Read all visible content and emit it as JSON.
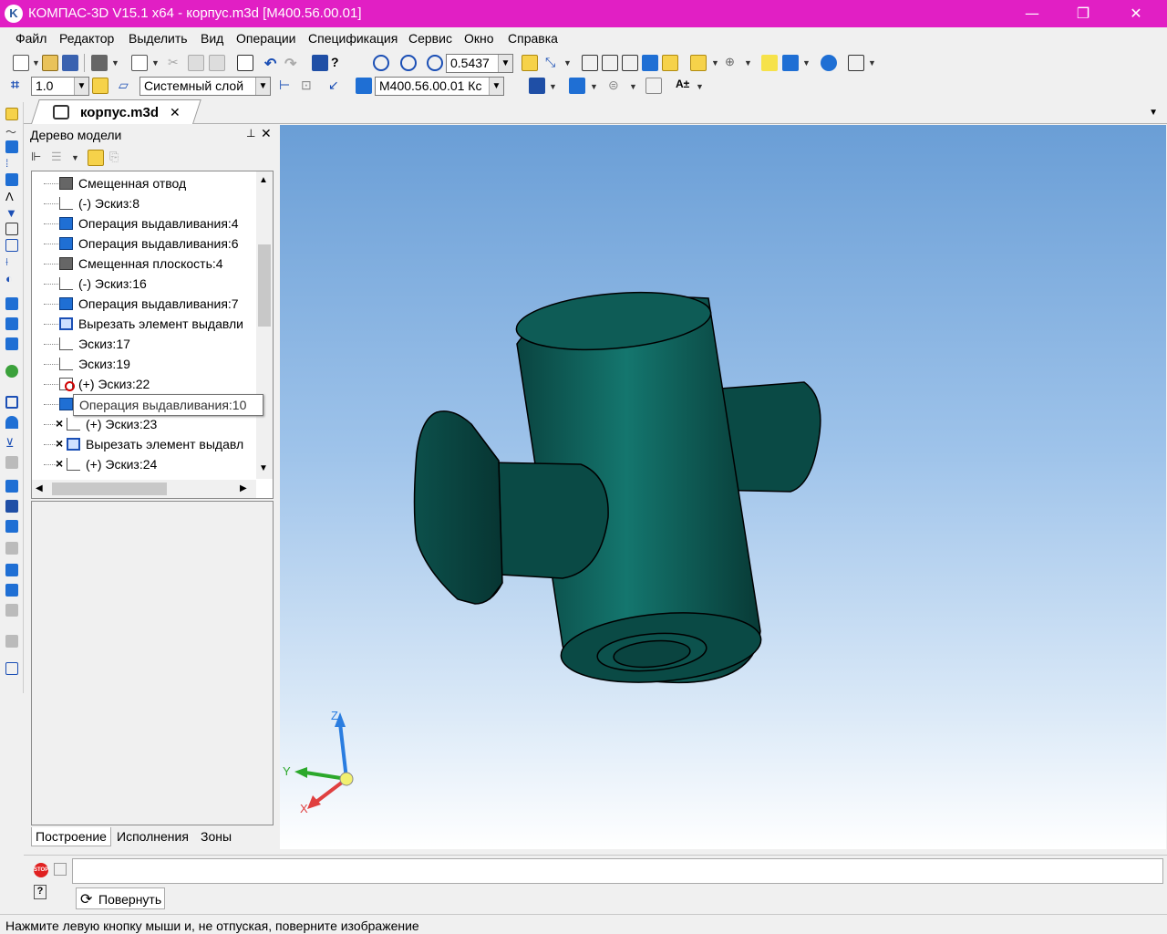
{
  "window": {
    "title": "КОМПАС-3D V15.1 x64 - корпус.m3d [M400.56.00.01]",
    "app_icon": "kompas-logo-icon",
    "controls": [
      "minimize-icon",
      "restore-icon",
      "close-icon"
    ]
  },
  "menu": [
    "Файл",
    "Редактор",
    "Выделить",
    "Вид",
    "Операции",
    "Спецификация",
    "Сервис",
    "Окно",
    "Справка"
  ],
  "toolbar": {
    "zoom_value": "0.5437",
    "step_value": "1.0",
    "layer_value": "Системный слой",
    "designation_value": "M400.56.00.01 Кс"
  },
  "document_tab": {
    "label": "корпус.m3d",
    "close": "✕"
  },
  "tree_panel": {
    "title": "Дерево модели",
    "items": [
      {
        "label": "Смещенная отвод",
        "icon": "plane-icon",
        "state": ""
      },
      {
        "label": "(-) Эскиз:8",
        "icon": "sketch-icon",
        "state": ""
      },
      {
        "label": "Операция выдавливания:4",
        "icon": "extrude-icon",
        "state": ""
      },
      {
        "label": "Операция выдавливания:6",
        "icon": "extrude-icon",
        "state": ""
      },
      {
        "label": "Смещенная плоскость:4",
        "icon": "plane-icon",
        "state": ""
      },
      {
        "label": "(-) Эскиз:16",
        "icon": "sketch-icon",
        "state": ""
      },
      {
        "label": "Операция выдавливания:7",
        "icon": "extrude-icon",
        "state": ""
      },
      {
        "label": "Вырезать элемент выдавли",
        "icon": "cut-extrude-icon",
        "state": ""
      },
      {
        "label": "Эскиз:17",
        "icon": "sketch-icon",
        "state": ""
      },
      {
        "label": "Эскиз:19",
        "icon": "sketch-icon",
        "state": ""
      },
      {
        "label": "(+) Эскиз:22",
        "icon": "sketch-error-icon",
        "state": "error"
      },
      {
        "label": "Операция выдавливания:10",
        "icon": "extrude-icon",
        "state": ""
      },
      {
        "label": "(+) Эскиз:23",
        "icon": "sketch-icon",
        "state": "excluded"
      },
      {
        "label": "Вырезать элемент выдавл",
        "icon": "cut-extrude-icon",
        "state": "excluded"
      },
      {
        "label": "(+) Эскиз:24",
        "icon": "sketch-icon",
        "state": "excluded"
      }
    ],
    "tooltip": "Операция выдавливания:10",
    "bottom_tabs": [
      "Построение",
      "Исполнения",
      "Зоны"
    ]
  },
  "axes": {
    "x": "X",
    "y": "Y",
    "z": "Z"
  },
  "command": {
    "rotate_label": "Повернуть"
  },
  "status_text": "Нажмите левую кнопку мыши и, не отпуская, поверните изображение",
  "colors": {
    "titlebar": "#e11fc4",
    "model": "#0d5550",
    "viewport_top": "#6a9ed6"
  }
}
